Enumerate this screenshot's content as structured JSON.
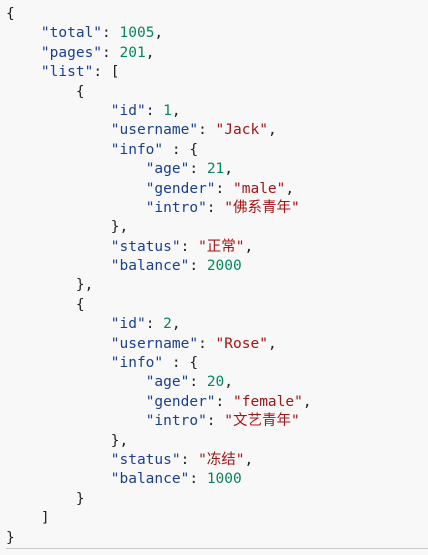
{
  "lines": [
    [
      {
        "t": "p",
        "v": "{"
      }
    ],
    [
      {
        "t": "p",
        "v": "    "
      },
      {
        "t": "key",
        "v": "\"total\""
      },
      {
        "t": "p",
        "v": ": "
      },
      {
        "t": "num",
        "v": "1005"
      },
      {
        "t": "p",
        "v": ","
      }
    ],
    [
      {
        "t": "p",
        "v": "    "
      },
      {
        "t": "key",
        "v": "\"pages\""
      },
      {
        "t": "p",
        "v": ": "
      },
      {
        "t": "num",
        "v": "201"
      },
      {
        "t": "p",
        "v": ","
      }
    ],
    [
      {
        "t": "p",
        "v": "    "
      },
      {
        "t": "key",
        "v": "\"list\""
      },
      {
        "t": "p",
        "v": ": ["
      }
    ],
    [
      {
        "t": "p",
        "v": "        {"
      }
    ],
    [
      {
        "t": "p",
        "v": "            "
      },
      {
        "t": "key",
        "v": "\"id\""
      },
      {
        "t": "p",
        "v": ": "
      },
      {
        "t": "num",
        "v": "1"
      },
      {
        "t": "p",
        "v": ","
      }
    ],
    [
      {
        "t": "p",
        "v": "            "
      },
      {
        "t": "key",
        "v": "\"username\""
      },
      {
        "t": "p",
        "v": ": "
      },
      {
        "t": "str",
        "v": "\"Jack\""
      },
      {
        "t": "p",
        "v": ","
      }
    ],
    [
      {
        "t": "p",
        "v": "            "
      },
      {
        "t": "key",
        "v": "\"info\""
      },
      {
        "t": "p",
        "v": " : {"
      }
    ],
    [
      {
        "t": "p",
        "v": "                "
      },
      {
        "t": "key",
        "v": "\"age\""
      },
      {
        "t": "p",
        "v": ": "
      },
      {
        "t": "num",
        "v": "21"
      },
      {
        "t": "p",
        "v": ","
      }
    ],
    [
      {
        "t": "p",
        "v": "                "
      },
      {
        "t": "key",
        "v": "\"gender\""
      },
      {
        "t": "p",
        "v": ": "
      },
      {
        "t": "str",
        "v": "\"male\""
      },
      {
        "t": "p",
        "v": ","
      }
    ],
    [
      {
        "t": "p",
        "v": "                "
      },
      {
        "t": "key",
        "v": "\"intro\""
      },
      {
        "t": "p",
        "v": ": "
      },
      {
        "t": "str",
        "v": "\"佛系青年\""
      }
    ],
    [
      {
        "t": "p",
        "v": "            },"
      }
    ],
    [
      {
        "t": "p",
        "v": "            "
      },
      {
        "t": "key",
        "v": "\"status\""
      },
      {
        "t": "p",
        "v": ": "
      },
      {
        "t": "str",
        "v": "\"正常\""
      },
      {
        "t": "p",
        "v": ","
      }
    ],
    [
      {
        "t": "p",
        "v": "            "
      },
      {
        "t": "key",
        "v": "\"balance\""
      },
      {
        "t": "p",
        "v": ": "
      },
      {
        "t": "num",
        "v": "2000"
      }
    ],
    [
      {
        "t": "p",
        "v": "        },"
      }
    ],
    [
      {
        "t": "p",
        "v": "        {"
      }
    ],
    [
      {
        "t": "p",
        "v": "            "
      },
      {
        "t": "key",
        "v": "\"id\""
      },
      {
        "t": "p",
        "v": ": "
      },
      {
        "t": "num",
        "v": "2"
      },
      {
        "t": "p",
        "v": ","
      }
    ],
    [
      {
        "t": "p",
        "v": "            "
      },
      {
        "t": "key",
        "v": "\"username\""
      },
      {
        "t": "p",
        "v": ": "
      },
      {
        "t": "str",
        "v": "\"Rose\""
      },
      {
        "t": "p",
        "v": ","
      }
    ],
    [
      {
        "t": "p",
        "v": "            "
      },
      {
        "t": "key",
        "v": "\"info\""
      },
      {
        "t": "p",
        "v": " : {"
      }
    ],
    [
      {
        "t": "p",
        "v": "                "
      },
      {
        "t": "key",
        "v": "\"age\""
      },
      {
        "t": "p",
        "v": ": "
      },
      {
        "t": "num",
        "v": "20"
      },
      {
        "t": "p",
        "v": ","
      }
    ],
    [
      {
        "t": "p",
        "v": "                "
      },
      {
        "t": "key",
        "v": "\"gender\""
      },
      {
        "t": "p",
        "v": ": "
      },
      {
        "t": "str",
        "v": "\"female\""
      },
      {
        "t": "p",
        "v": ","
      }
    ],
    [
      {
        "t": "p",
        "v": "                "
      },
      {
        "t": "key",
        "v": "\"intro\""
      },
      {
        "t": "p",
        "v": ": "
      },
      {
        "t": "str",
        "v": "\"文艺青年\""
      }
    ],
    [
      {
        "t": "p",
        "v": "            },"
      }
    ],
    [
      {
        "t": "p",
        "v": "            "
      },
      {
        "t": "key",
        "v": "\"status\""
      },
      {
        "t": "p",
        "v": ": "
      },
      {
        "t": "str",
        "v": "\"冻结\""
      },
      {
        "t": "p",
        "v": ","
      }
    ],
    [
      {
        "t": "p",
        "v": "            "
      },
      {
        "t": "key",
        "v": "\"balance\""
      },
      {
        "t": "p",
        "v": ": "
      },
      {
        "t": "num",
        "v": "1000"
      }
    ],
    [
      {
        "t": "p",
        "v": "        }"
      }
    ],
    [
      {
        "t": "p",
        "v": "    ]"
      }
    ],
    [
      {
        "t": "p",
        "v": "}"
      }
    ]
  ],
  "colors": {
    "background": "#f8f8f8",
    "key": "#1a3f8f",
    "number": "#098658",
    "string": "#a31515",
    "punctuation": "#1f1f1f"
  }
}
